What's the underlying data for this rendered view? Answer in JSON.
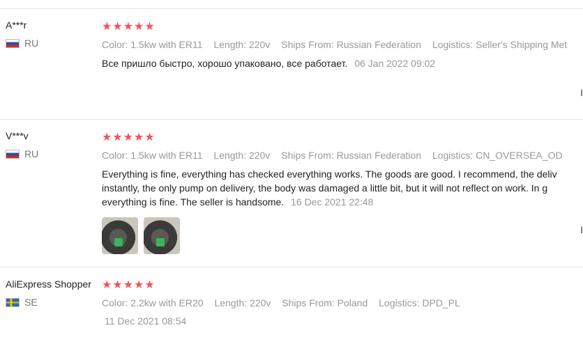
{
  "reviews": [
    {
      "user": "A***r",
      "country": "RU",
      "stars": "★★★★★",
      "color_label": "Color:",
      "color": "1.5kw with ER11",
      "length_label": "Length:",
      "length": "220v",
      "ships_label": "Ships From:",
      "ships": "Russian Federation",
      "logistics_label": "Logistics:",
      "logistics": "Seller's Shipping Met",
      "text": "Все пришло быстро, хорошо упаковано, все работает.",
      "date": "06 Jan 2022 09:02",
      "helpful": "I"
    },
    {
      "user": "V***v",
      "country": "RU",
      "stars": "★★★★★",
      "color_label": "Color:",
      "color": "1.5kw with ER11",
      "length_label": "Length:",
      "length": "220v",
      "ships_label": "Ships From:",
      "ships": "Russian Federation",
      "logistics_label": "Logistics:",
      "logistics": "CN_OVERSEA_OD",
      "text_line1": "Everything is fine, everything has checked everything works. The goods are good. I recommend, the deliv",
      "text_line2": "instantly, the only pump on delivery, the body was damaged a little bit, but it will not reflect on work. In g",
      "text_line3": "everything is fine. The seller is handsome.",
      "date": "16 Dec 2021 22:48",
      "helpful": "I"
    },
    {
      "user": "AliExpress Shopper",
      "country": "SE",
      "stars": "★★★★★",
      "color_label": "Color:",
      "color": "2.2kw with ER20",
      "length_label": "Length:",
      "length": "220v",
      "ships_label": "Ships From:",
      "ships": "Poland",
      "logistics_label": "Logistics:",
      "logistics": "DPD_PL",
      "date": "11 Dec 2021 08:54"
    }
  ]
}
